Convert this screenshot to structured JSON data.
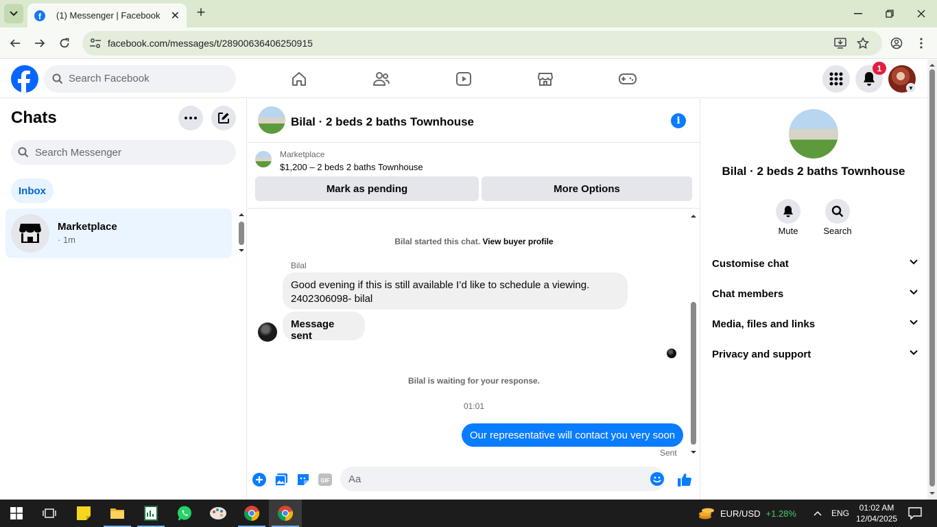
{
  "browser": {
    "tab_title": "(1) Messenger | Facebook",
    "url": "facebook.com/messages/t/28900636406250915"
  },
  "header": {
    "search_placeholder": "Search Facebook",
    "notification_count": "1",
    "nav_icons": [
      "home-icon",
      "friends-icon",
      "video-icon",
      "marketplace-icon",
      "gaming-icon"
    ]
  },
  "chats": {
    "title": "Chats",
    "search_placeholder": "Search Messenger",
    "filter_label": "Inbox",
    "items": [
      {
        "name": "Marketplace",
        "time": "· 1m"
      }
    ]
  },
  "conversation": {
    "title": "Bilal · 2 beds 2 baths Townhouse",
    "marketplace_label": "Marketplace",
    "listing": "$1,200 – 2 beds 2 baths Townhouse",
    "mark_pending_label": "Mark as pending",
    "more_options_label": "More Options",
    "system_start": "Bilal started this chat.",
    "view_profile_link": "View buyer profile",
    "sender_name": "Bilal",
    "incoming_message": "Good evening if this is still available I’d like to schedule a viewing. 2402306098- bilal",
    "message_sent_label": "Message sent",
    "waiting_text": "Bilal is waiting for your response.",
    "timestamp": "01:01",
    "outgoing_message": "Our representative will contact you very soon",
    "sent_status": "Sent",
    "composer_placeholder": "Aa"
  },
  "right_panel": {
    "title": "Bilal · 2 beds 2 baths Townhouse",
    "mute_label": "Mute",
    "search_label": "Search",
    "sections": [
      "Customise chat",
      "Chat members",
      "Media, files and links",
      "Privacy and support"
    ]
  },
  "taskbar": {
    "ticker_symbol": "EUR/USD",
    "ticker_change": "+1.28%",
    "language": "ENG",
    "time": "01:02 AM",
    "date": "12/04/2025"
  },
  "colors": {
    "accent": "#0a7cff",
    "fb_blue": "#0866ff",
    "chrome_bg": "#dbe9cf"
  }
}
